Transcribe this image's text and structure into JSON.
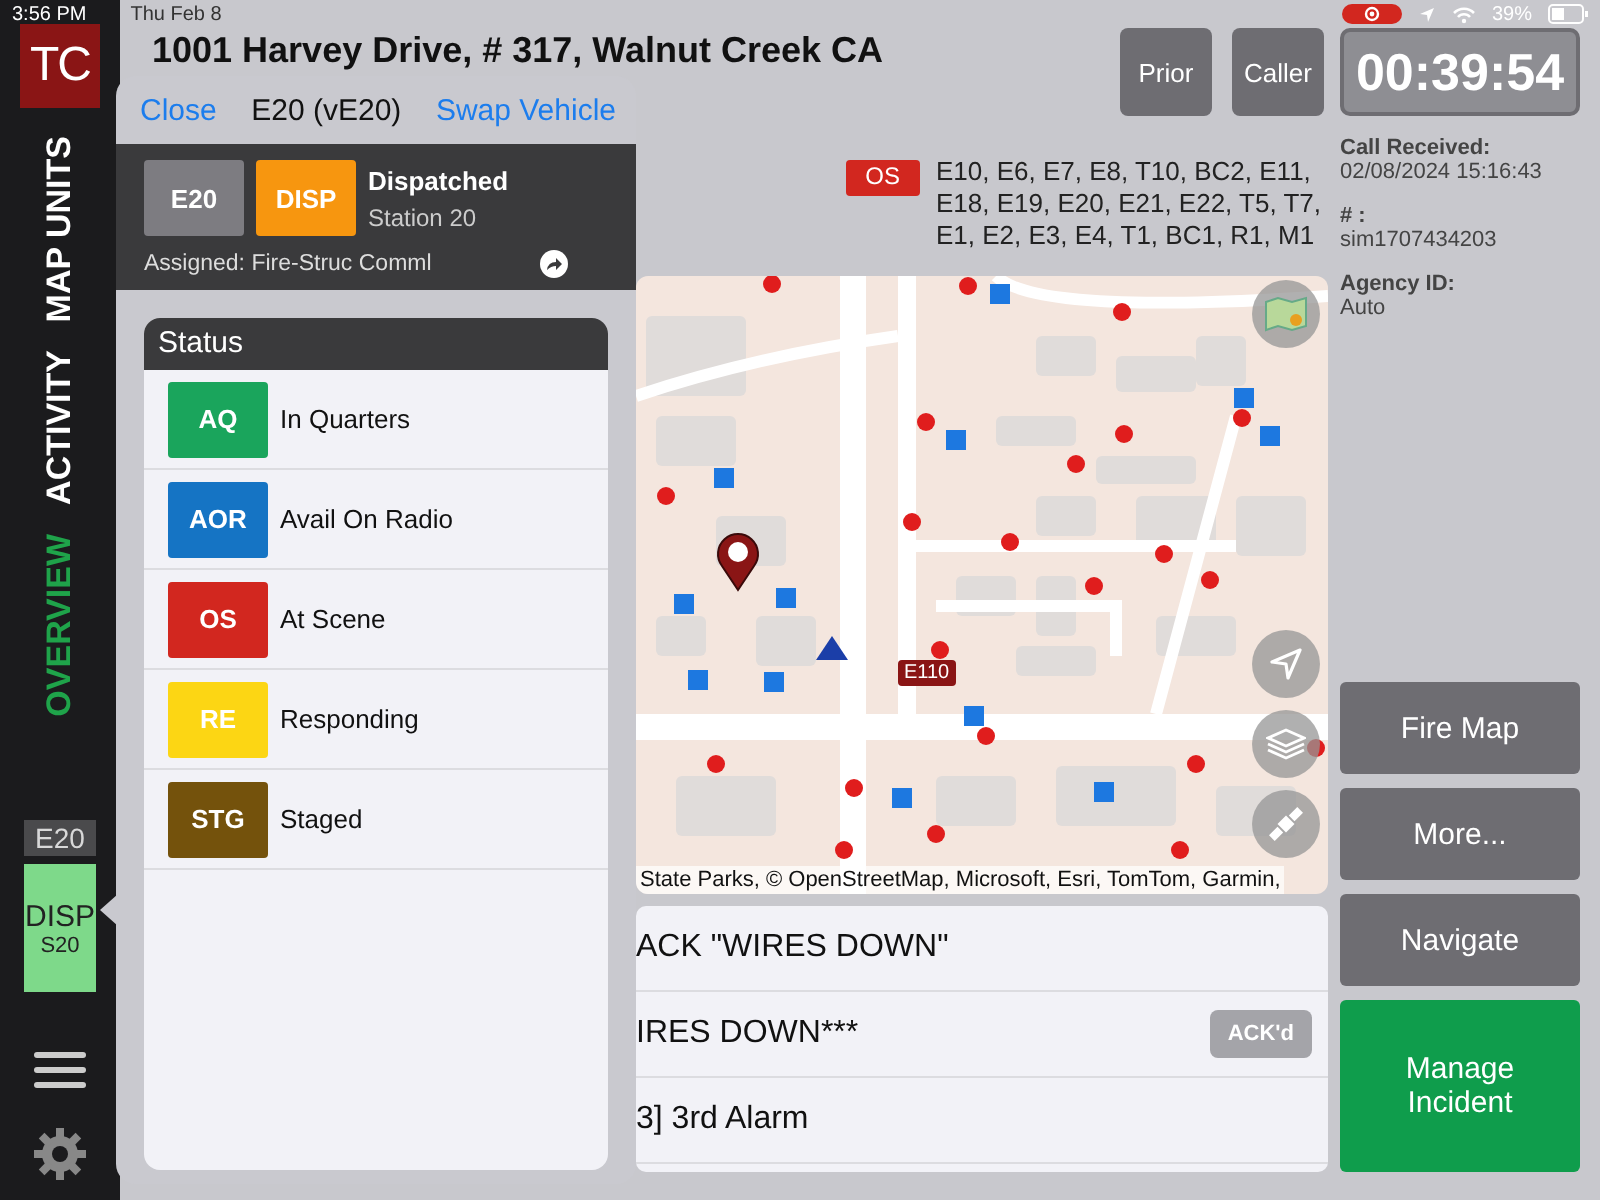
{
  "status_bar": {
    "time": "3:56 PM",
    "date": "Thu Feb 8",
    "battery": "39%"
  },
  "sidebar": {
    "logo": "TC",
    "tabs": [
      {
        "label": "MAP UNITS",
        "selected": false
      },
      {
        "label": "ACTIVITY",
        "selected": false
      },
      {
        "label": "OVERVIEW",
        "selected": true
      }
    ],
    "unit": {
      "name": "E20",
      "status": "DISP",
      "station": "S20"
    }
  },
  "header": {
    "address": "1001 Harvey Drive, # 317, Walnut Creek CA",
    "buttons": [
      "Prior",
      "Caller"
    ],
    "timer": "00:39:54"
  },
  "units": {
    "status": "OS",
    "list": "E10, E6, E7, E8, T10, BC2, E11, E18, E19, E20, E21, E22, T5, T7, E1, E2, E3, E4, T1, BC1, R1, M1"
  },
  "call_info": [
    {
      "label": "Call Received:",
      "value": "02/08/2024 15:16:43"
    },
    {
      "label": "# :",
      "value": "sim1707434203"
    },
    {
      "label": "Agency ID:",
      "value": "Auto"
    }
  ],
  "map": {
    "marker_label": "E110",
    "attribution": "State Parks, © OpenStreetMap, Microsoft, Esri, TomTom, Garmin,"
  },
  "messages": [
    {
      "text": "ACK \"WIRES DOWN\""
    },
    {
      "text": "IRES DOWN***",
      "button": {
        "label": "ACK'd",
        "disabled": true
      }
    },
    {
      "text": "3] 3rd Alarm"
    }
  ],
  "actions": [
    {
      "label": "Fire Map",
      "kind": "secondary"
    },
    {
      "label": "More...",
      "kind": "secondary"
    },
    {
      "label": "Navigate",
      "kind": "secondary"
    },
    {
      "label": "Manage Incident",
      "kind": "primary"
    }
  ],
  "popover": {
    "close": "Close",
    "title": "E20 (vE20)",
    "swap": "Swap Vehicle",
    "unit": "E20",
    "status_code": "DISP",
    "status_name": "Dispatched",
    "station": "Station 20",
    "assigned": "Assigned: Fire-Struc Comml",
    "status_title": "Status",
    "statuses": [
      {
        "code": "AQ",
        "label": "In Quarters",
        "color": "#1aa55c"
      },
      {
        "code": "AOR",
        "label": "Avail On Radio",
        "color": "#1574c4"
      },
      {
        "code": "OS",
        "label": "At Scene",
        "color": "#d2271f"
      },
      {
        "code": "RE",
        "label": "Responding",
        "color": "#fcd614"
      },
      {
        "code": "STG",
        "label": "Staged",
        "color": "#74520c"
      }
    ]
  }
}
